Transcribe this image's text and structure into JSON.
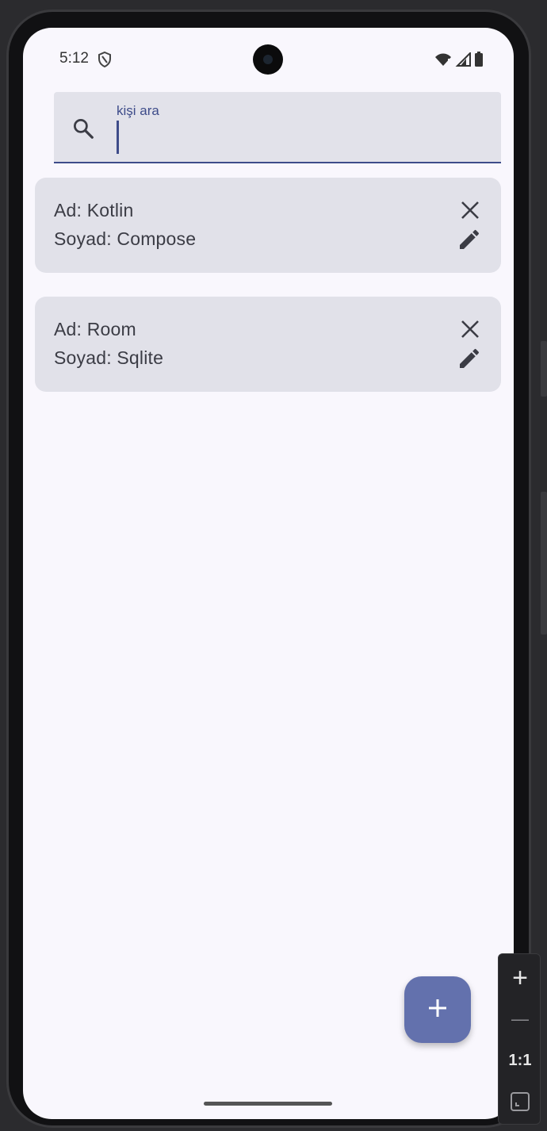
{
  "status_bar": {
    "time": "5:12"
  },
  "search": {
    "label": "kişi ara",
    "value": ""
  },
  "contacts": [
    {
      "first_line": "Ad: Kotlin",
      "second_line": "Soyad: Compose"
    },
    {
      "first_line": "Ad: Room",
      "second_line": "Soyad: Sqlite"
    }
  ],
  "emulator_controls": {
    "zoom_in": "+",
    "zoom_out": "—",
    "ratio": "1:1"
  },
  "colors": {
    "accent": "#3e4c8a",
    "fab": "#6371ad",
    "card": "#e1e1e9",
    "screen_bg": "#f9f7fd"
  }
}
